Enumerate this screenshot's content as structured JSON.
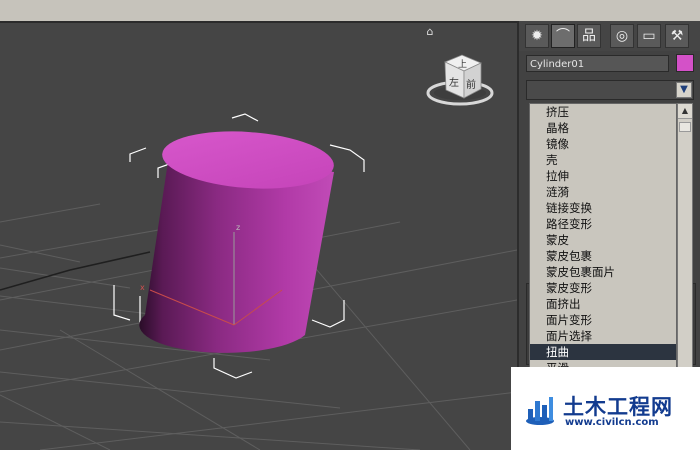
{
  "viewport": {
    "home_icon": "home-icon",
    "viewcube_labels": {
      "top": "上",
      "front": "前",
      "left": "左"
    }
  },
  "command_panel": {
    "tabs": [
      {
        "name": "create",
        "icon": "sun-icon"
      },
      {
        "name": "modify",
        "icon": "curve-icon"
      },
      {
        "name": "hierarchy",
        "icon": "hierarchy-icon"
      },
      {
        "name": "motion",
        "icon": "circle-icon"
      },
      {
        "name": "display",
        "icon": "monitor-icon"
      },
      {
        "name": "utilities",
        "icon": "hammer-icon"
      }
    ],
    "object_name": "Cylinder01",
    "object_color": "#d451c8",
    "modifier_list_value": "",
    "modifiers": [
      "挤压",
      "晶格",
      "镜像",
      "壳",
      "拉伸",
      "涟漪",
      "链接变换",
      "路径变形",
      "蒙皮",
      "蒙皮包裹",
      "蒙皮包裹面片",
      "蒙皮变形",
      "面挤出",
      "面片变形",
      "面片选择",
      "扭曲",
      "平滑"
    ],
    "selected_modifier": "扭曲"
  },
  "watermark": {
    "title": "土木工程网",
    "url": "www.civilcn.com"
  },
  "colors": {
    "cylinder": "#c23db5",
    "selection_bracket": "#ffffff",
    "grid": "#5e5e5e"
  }
}
